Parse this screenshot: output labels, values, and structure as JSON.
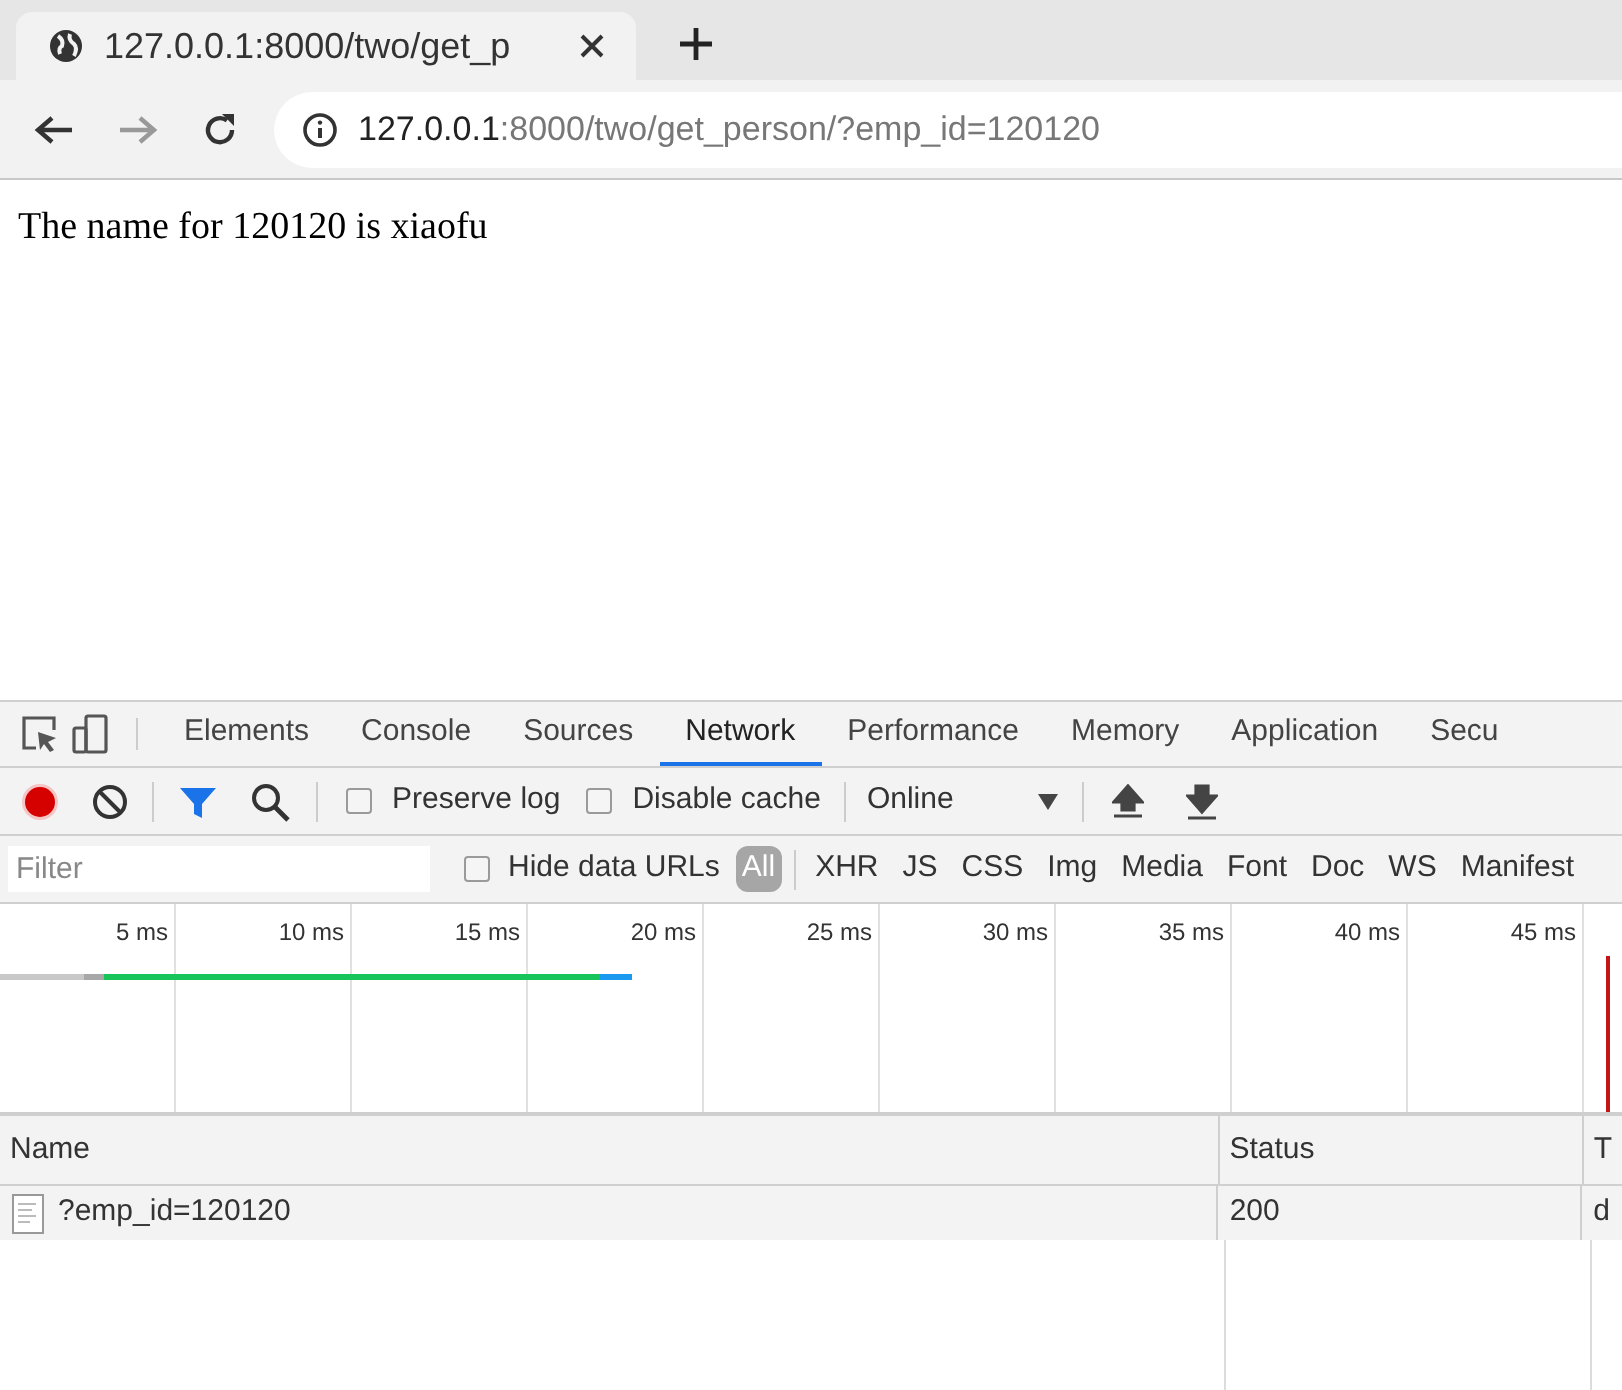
{
  "browser_tab": {
    "title": "127.0.0.1:8000/two/get_p",
    "selected": true
  },
  "address_bar": {
    "host": "127.0.0.1",
    "rest": ":8000/two/get_person/?emp_id=120120"
  },
  "page": {
    "text": "The name for 120120 is xiaofu"
  },
  "devtools": {
    "tabs": [
      {
        "label": "Elements",
        "selected": false
      },
      {
        "label": "Console",
        "selected": false
      },
      {
        "label": "Sources",
        "selected": false
      },
      {
        "label": "Network",
        "selected": true
      },
      {
        "label": "Performance",
        "selected": false
      },
      {
        "label": "Memory",
        "selected": false
      },
      {
        "label": "Application",
        "selected": false
      },
      {
        "label": "Secu",
        "selected": false
      }
    ],
    "toolbar": {
      "recording": true,
      "filter_active": true,
      "preserve_log": {
        "label": "Preserve log",
        "checked": false
      },
      "disable_cache": {
        "label": "Disable cache",
        "checked": false
      },
      "throttling": "Online"
    },
    "filter_bar": {
      "placeholder": "Filter",
      "hide_data_urls": {
        "label": "Hide data URLs",
        "checked": false
      },
      "types": [
        {
          "label": "All",
          "selected": true
        },
        {
          "label": "XHR",
          "selected": false
        },
        {
          "label": "JS",
          "selected": false
        },
        {
          "label": "CSS",
          "selected": false
        },
        {
          "label": "Img",
          "selected": false
        },
        {
          "label": "Media",
          "selected": false
        },
        {
          "label": "Font",
          "selected": false
        },
        {
          "label": "Doc",
          "selected": false
        },
        {
          "label": "WS",
          "selected": false
        },
        {
          "label": "Manifest",
          "selected": false
        }
      ]
    },
    "overview_ticks": [
      "5 ms",
      "10 ms",
      "15 ms",
      "20 ms",
      "25 ms",
      "30 ms",
      "35 ms",
      "40 ms",
      "45 ms"
    ],
    "table": {
      "columns": [
        "Name",
        "Status",
        "T"
      ],
      "rows": [
        {
          "name": "?emp_id=120120",
          "status": "200",
          "column_3": "d"
        }
      ]
    }
  }
}
